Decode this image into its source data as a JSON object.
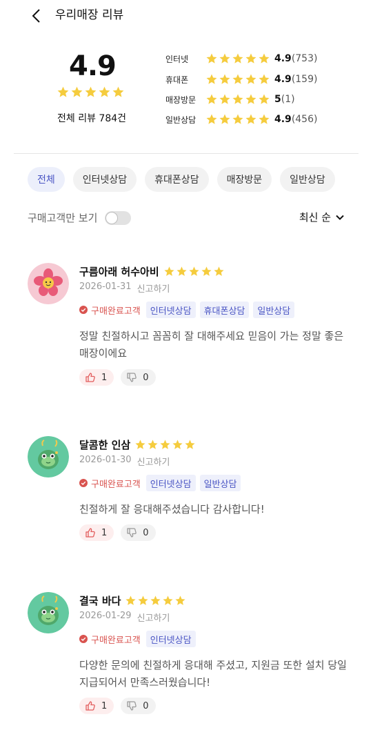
{
  "header": {
    "title": "우리매장 리뷰",
    "back_icon": "chevron-left-icon"
  },
  "summary": {
    "score": "4.9",
    "total_prefix": "전체 리뷰 ",
    "total_count": "784건",
    "categories": [
      {
        "label": "인터넷",
        "score": "4.9",
        "count": "(753)"
      },
      {
        "label": "휴대폰",
        "score": "4.9",
        "count": "(159)"
      },
      {
        "label": "매장방문",
        "score": "5",
        "count": "(1)"
      },
      {
        "label": "일반상담",
        "score": "4.9",
        "count": "(456)"
      }
    ]
  },
  "filters": {
    "chips": [
      "전체",
      "인터넷상담",
      "휴대폰상담",
      "매장방문",
      "일반상담"
    ],
    "active_chip": "전체",
    "buyer_only_label": "구매고객만 보기",
    "sort_label": "최신 순"
  },
  "colors": {
    "star": "#f5cc3e",
    "accent": "#4a55c4",
    "buyer": "#d9534f",
    "like": "#e25c5c"
  },
  "reviews": [
    {
      "nickname": "구름아래 허수아비",
      "date": "2026-01-31",
      "report": "신고하기",
      "buyer_badge": "구매완료고객",
      "tags": [
        "인터넷상담",
        "휴대폰상담",
        "일반상담"
      ],
      "text": "정말 친절하시고 꼼꼼히 잘 대해주세요 믿음이 가는 정말 좋은 매장이에요",
      "likes": "1",
      "dislikes": "0",
      "avatar": "flower-avatar"
    },
    {
      "nickname": "달콤한 인삼",
      "date": "2026-01-30",
      "report": "신고하기",
      "buyer_badge": "구매완료고객",
      "tags": [
        "인터넷상담",
        "일반상담"
      ],
      "text": "친절하게 잘 응대해주셨습니다 감사합니다!",
      "likes": "1",
      "dislikes": "0",
      "avatar": "ginseng-avatar"
    },
    {
      "nickname": "결국 바다",
      "date": "2026-01-29",
      "report": "신고하기",
      "buyer_badge": "구매완료고객",
      "tags": [
        "인터넷상담"
      ],
      "text": "다양한 문의에 친절하게 응대해 주셨고, 지원금 또한 설치 당일 지급되어서 만족스러웠습니다!",
      "likes": "1",
      "dislikes": "0",
      "avatar": "ginseng-avatar"
    }
  ]
}
